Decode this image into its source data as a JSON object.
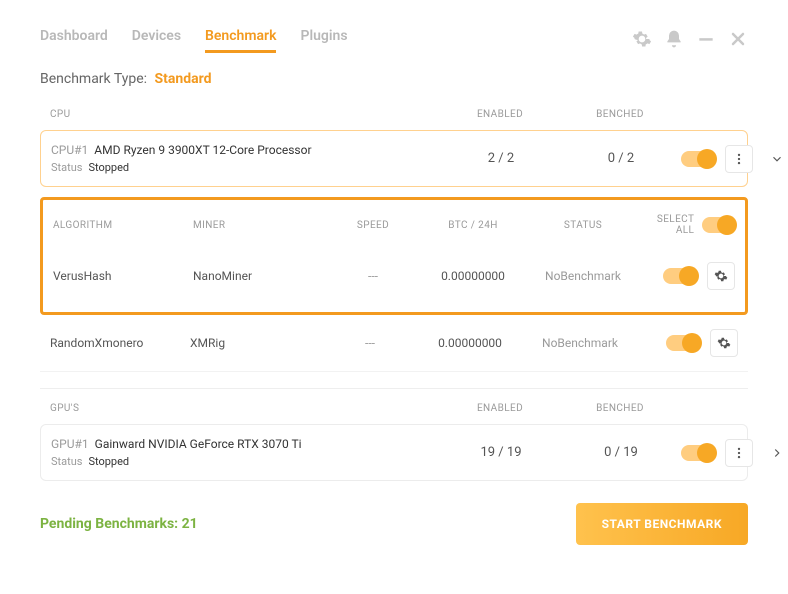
{
  "nav": {
    "tabs": [
      "Dashboard",
      "Devices",
      "Benchmark",
      "Plugins"
    ],
    "active": 2
  },
  "benchmark_type": {
    "label": "Benchmark Type:",
    "value": "Standard"
  },
  "cpu": {
    "header": {
      "title": "CPU",
      "enabled": "ENABLED",
      "benched": "BENCHED"
    },
    "id": "CPU#1",
    "name": "AMD Ryzen 9 3900XT 12-Core Processor",
    "status_label": "Status",
    "status": "Stopped",
    "enabled": "2 / 2",
    "benched": "0 / 2"
  },
  "alg_header": {
    "algorithm": "ALGORITHM",
    "miner": "MINER",
    "speed": "SPEED",
    "btc": "BTC / 24H",
    "status": "STATUS",
    "select_all": "SELECT ALL"
  },
  "algs": [
    {
      "algorithm": "VerusHash",
      "miner": "NanoMiner",
      "speed": "---",
      "btc": "0.00000000",
      "status": "NoBenchmark"
    },
    {
      "algorithm": "RandomXmonero",
      "miner": "XMRig",
      "speed": "---",
      "btc": "0.00000000",
      "status": "NoBenchmark"
    }
  ],
  "gpu": {
    "header": {
      "title": "GPU'S",
      "enabled": "ENABLED",
      "benched": "BENCHED"
    },
    "id": "GPU#1",
    "name": "Gainward NVIDIA GeForce RTX 3070 Ti",
    "status_label": "Status",
    "status": "Stopped",
    "enabled": "19 / 19",
    "benched": "0 / 19"
  },
  "footer": {
    "pending": "Pending Benchmarks: 21",
    "start": "START BENCHMARK"
  }
}
